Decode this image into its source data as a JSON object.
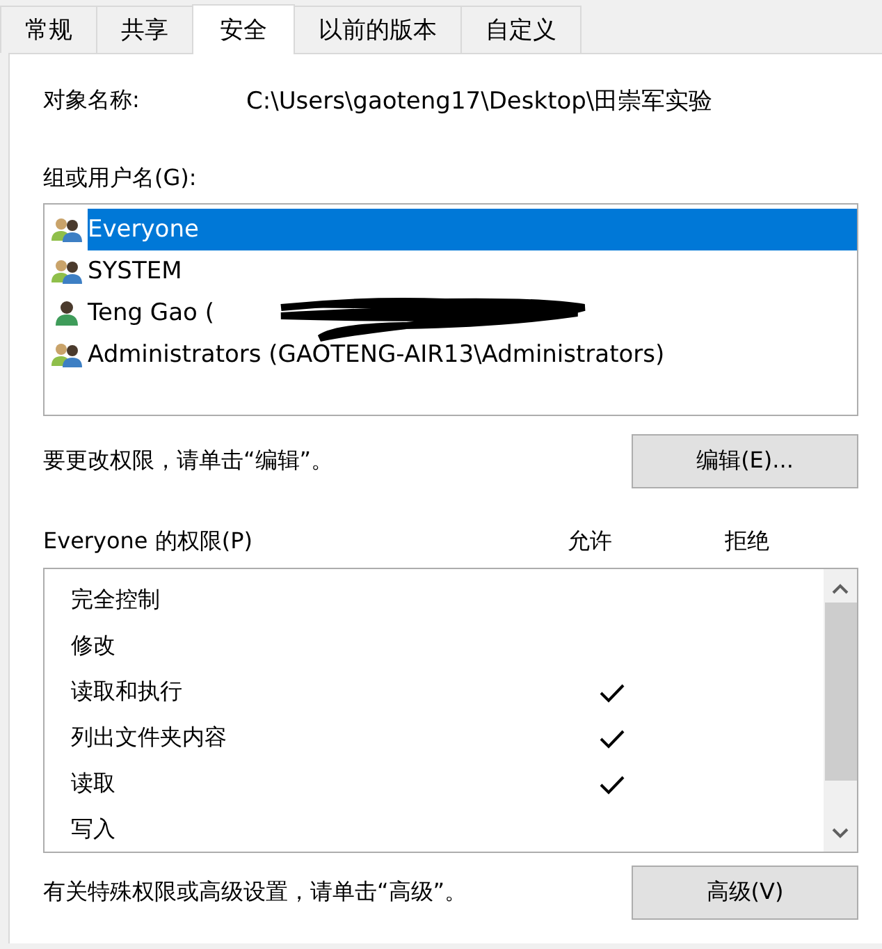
{
  "tabs": [
    {
      "label": "常规",
      "selected": false
    },
    {
      "label": "共享",
      "selected": false
    },
    {
      "label": "安全",
      "selected": true
    },
    {
      "label": "以前的版本",
      "selected": false
    },
    {
      "label": "自定义",
      "selected": false
    }
  ],
  "object_name": {
    "label": "对象名称:",
    "value": "C:\\Users\\gaoteng17\\Desktop\\田崇军实验"
  },
  "groups": {
    "label": "组或用户名(G):",
    "items": [
      {
        "kind": "group",
        "name": "Everyone",
        "selected": true
      },
      {
        "kind": "group",
        "name": "SYSTEM",
        "selected": false
      },
      {
        "kind": "user",
        "name": "Teng Gao (",
        "redacted": true,
        "selected": false
      },
      {
        "kind": "group",
        "name": "Administrators (GAOTENG-AIR13\\Administrators)",
        "selected": false
      }
    ]
  },
  "edit_hint": "要更改权限，请单击“编辑”。",
  "edit_button": "编辑(E)...",
  "permissions": {
    "title": "Everyone 的权限(P)",
    "allow_header": "允许",
    "deny_header": "拒绝",
    "rows": [
      {
        "name": "完全控制",
        "allow": false,
        "deny": false
      },
      {
        "name": "修改",
        "allow": false,
        "deny": false
      },
      {
        "name": "读取和执行",
        "allow": true,
        "deny": false
      },
      {
        "name": "列出文件夹内容",
        "allow": true,
        "deny": false
      },
      {
        "name": "读取",
        "allow": true,
        "deny": false
      },
      {
        "name": "写入",
        "allow": false,
        "deny": false
      }
    ]
  },
  "advanced_hint": "有关特殊权限或高级设置，请单击“高级”。",
  "advanced_button": "高级(V)"
}
